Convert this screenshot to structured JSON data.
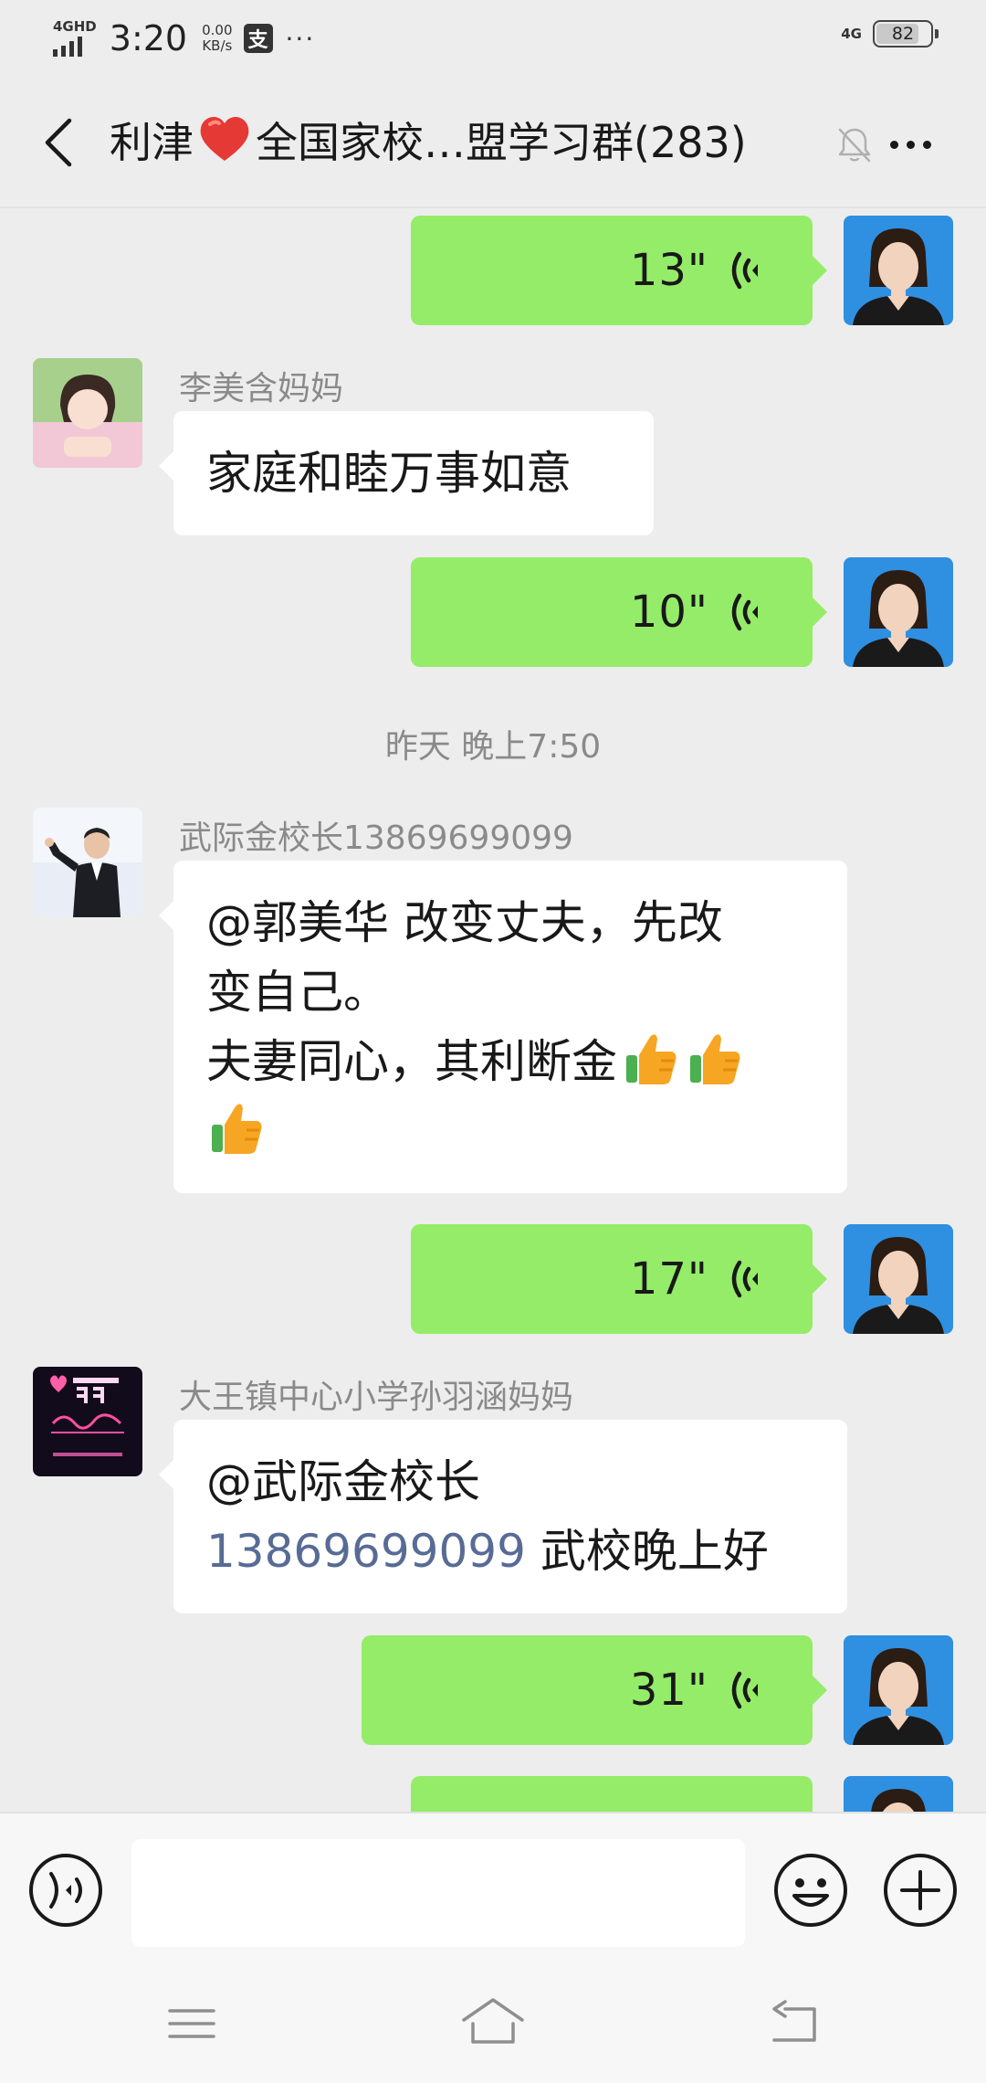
{
  "status_bar": {
    "network_type": "4GHD",
    "time": "3:20",
    "net_speed_value": "0.00",
    "net_speed_unit": "KB/s",
    "alipay_glyph": "支",
    "more": "···",
    "net_right": "4G",
    "battery": "82",
    "battery_level": 0.82
  },
  "header": {
    "title_prefix": "利津",
    "title_suffix": "全国家校…盟学习群(283)",
    "icons": [
      "back-icon",
      "heart-icon",
      "mute-bell-icon",
      "more-icon"
    ]
  },
  "messages": [
    {
      "type": "voice",
      "self": true,
      "duration": "13\""
    },
    {
      "type": "text",
      "self": false,
      "sender": "李美含妈妈",
      "lines": [
        "家庭和睦万事如意"
      ]
    },
    {
      "type": "voice",
      "self": true,
      "duration": "10\""
    },
    {
      "type": "timestamp",
      "text": "昨天 晚上7:50"
    },
    {
      "type": "text",
      "self": false,
      "sender": "武际金校长13869699099",
      "lines": [
        "@郭美华  改变丈夫，先改",
        "变自己。",
        "夫妻同心，其利断金"
      ],
      "emoji": "thumbs-up-icon"
    },
    {
      "type": "voice",
      "self": true,
      "duration": "17\""
    },
    {
      "type": "text",
      "self": false,
      "sender": "大王镇中心小学孙羽涵妈妈",
      "mention": "@武际金校长",
      "link": "13869699099",
      "tail": " 武校晚上好"
    },
    {
      "type": "voice",
      "self": true,
      "duration": "31\""
    }
  ],
  "input_bar": {
    "placeholder": "",
    "icons": [
      "voice-input-icon",
      "emoji-icon",
      "plus-icon"
    ]
  },
  "nav_bar": {
    "icons": [
      "menu-icon",
      "home-icon",
      "back-nav-icon"
    ]
  },
  "colors": {
    "background": "#ededed",
    "self_bubble": "#95ec69",
    "other_bubble": "#ffffff",
    "link": "#576b95",
    "secondary_text": "#8a8a8a"
  }
}
